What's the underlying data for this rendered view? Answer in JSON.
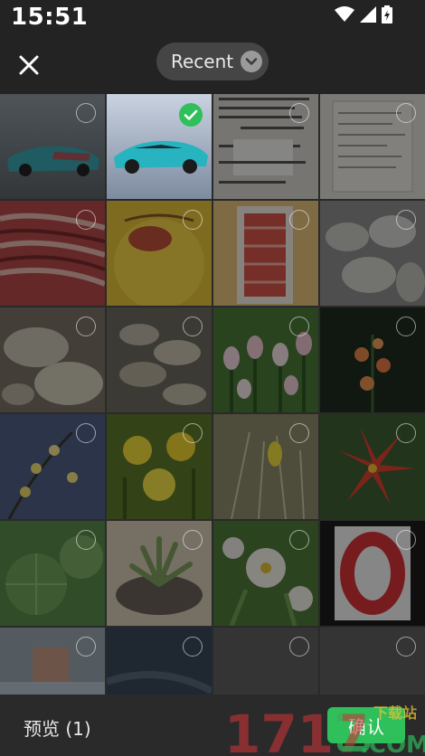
{
  "status_bar": {
    "time": "15:51"
  },
  "header": {
    "album_label": "Recent"
  },
  "grid": {
    "rows": 6,
    "columns": 4,
    "selected_index": 1
  },
  "footer": {
    "preview_label": "预览 (1)",
    "confirm_label": "确认"
  },
  "watermark": {
    "text_top": "下载站",
    "number": "1717",
    "suffix": "COM"
  },
  "colors": {
    "accent": "#2fbf5b",
    "background": "#2a2a2a",
    "bar": "#232323"
  }
}
